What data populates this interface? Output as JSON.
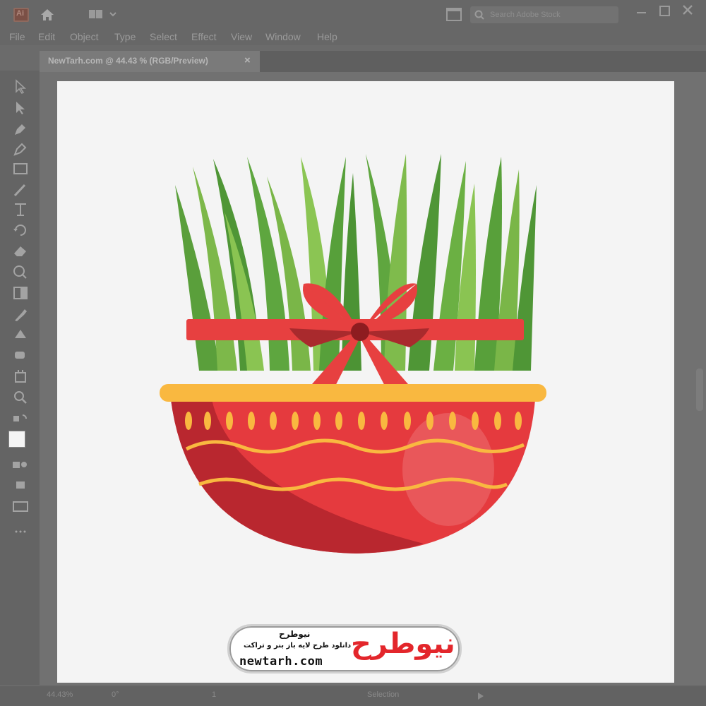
{
  "app": {
    "icon_label": "Ai",
    "menu": [
      "File",
      "Edit",
      "Object",
      "Type",
      "Select",
      "Effect",
      "View",
      "Window",
      "Help"
    ],
    "search_placeholder": "Search Adobe Stock"
  },
  "document": {
    "tab_title": "NewTarh.com @ 44.43 % (RGB/Preview)",
    "close_label": "×"
  },
  "status": {
    "zoom": "44.43%",
    "rotation": "0°",
    "artboard": "1",
    "mode": "Selection"
  },
  "watermark": {
    "brand_fa": "نیوطرح",
    "tagline_fa": "دانلود طرح لایه باز بنر و تراکت",
    "url": "newtarh.com",
    "logo_text": "نیوطرح"
  },
  "colors": {
    "chrome": "#676767",
    "artboard": "#f4f4f4",
    "bowl_red": "#e53a3e",
    "bowl_dark": "#b9272f",
    "rim_yellow": "#f9b840",
    "grass_light": "#7ab648",
    "grass_dark": "#58a03a",
    "ribbon": "#e74040",
    "logo_red": "#e3262b"
  }
}
